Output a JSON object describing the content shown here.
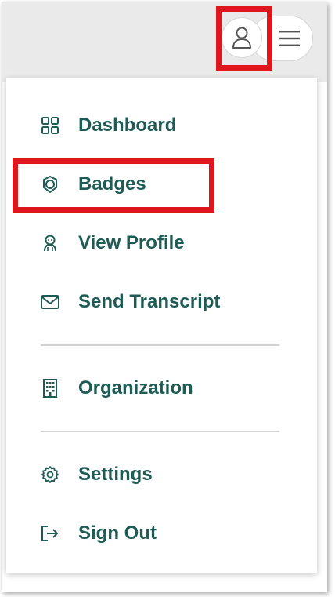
{
  "header": {
    "user_icon": "user-icon",
    "menu_icon": "hamburger-menu-icon"
  },
  "menu": {
    "items": [
      {
        "label": "Dashboard",
        "icon": "dashboard-grid-icon"
      },
      {
        "label": "Badges",
        "icon": "badge-icon"
      },
      {
        "label": "View Profile",
        "icon": "profile-icon"
      },
      {
        "label": "Send Transcript",
        "icon": "envelope-icon"
      },
      {
        "label": "Organization",
        "icon": "building-icon"
      },
      {
        "label": "Settings",
        "icon": "gear-icon"
      },
      {
        "label": "Sign Out",
        "icon": "sign-out-icon"
      }
    ]
  },
  "colors": {
    "text": "#1f5b55",
    "highlight": "#e0161f",
    "topbar": "#eaeaea"
  }
}
